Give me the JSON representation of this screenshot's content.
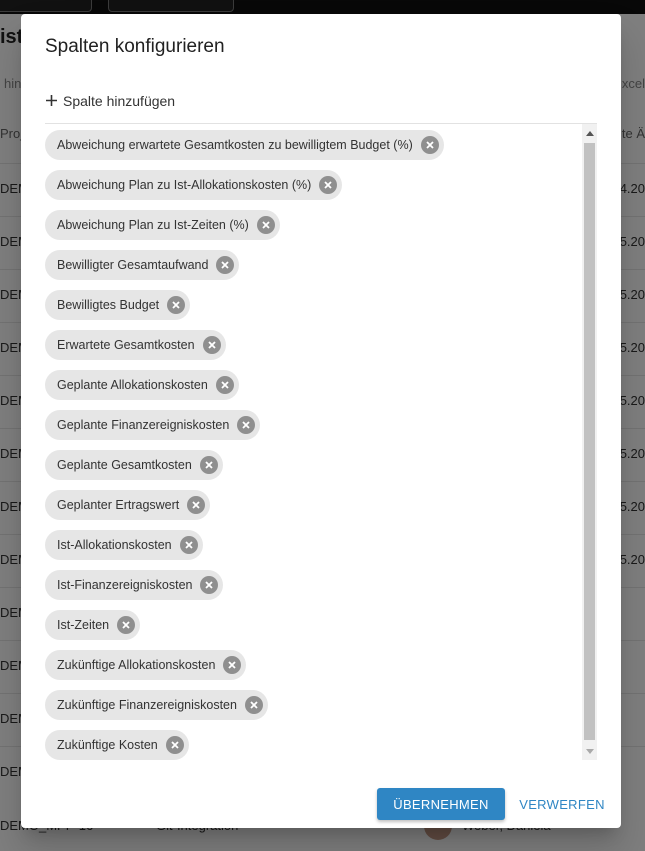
{
  "background": {
    "title_fragment": "ist",
    "hint_fragment": "hin",
    "excel_fragment": "xcel",
    "col_proj_fragment": "Proj",
    "col_right_fragment": "te Ä",
    "rows": [
      {
        "left": "DEM",
        "right": "4.20"
      },
      {
        "left": "DEM",
        "right": "5.20"
      },
      {
        "left": "DEM",
        "right": "5.20"
      },
      {
        "left": "DEM",
        "right": "5.20"
      },
      {
        "left": "DEM",
        "right": "5.20"
      },
      {
        "left": "DEM",
        "right": "5.20"
      },
      {
        "left": "DEM",
        "right": "5.20"
      },
      {
        "left": "DEM",
        "right": "5.20"
      },
      {
        "left": "DEM",
        "right": ""
      },
      {
        "left": "DEM",
        "right": ""
      },
      {
        "left": "DEM",
        "right": ""
      },
      {
        "left": "DEM",
        "right": ""
      }
    ],
    "last_row": {
      "left": "DEMO_MPP-16",
      "middle": "Git-Integration",
      "right": "Weber, Daniela"
    }
  },
  "dialog": {
    "title": "Spalten konfigurieren",
    "add_column": {
      "icon": "plus-icon",
      "label": "Spalte hinzufügen"
    },
    "columns": [
      "Abweichung erwartete Gesamtkosten zu bewilligtem Budget (%)",
      "Abweichung Plan zu Ist-Allokationskosten (%)",
      "Abweichung Plan zu Ist-Zeiten (%)",
      "Bewilligter Gesamtaufwand",
      "Bewilligtes Budget",
      "Erwartete Gesamtkosten",
      "Geplante Allokationskosten",
      "Geplante Finanzereigniskosten",
      "Geplante Gesamtkosten",
      "Geplanter Ertragswert",
      "Ist-Allokationskosten",
      "Ist-Finanzereigniskosten",
      "Ist-Zeiten",
      "Zukünftige Allokationskosten",
      "Zukünftige Finanzereigniskosten",
      "Zukünftige Kosten"
    ],
    "chip_remove_icon": "close-circle-icon",
    "buttons": {
      "apply": "ÜBERNEHMEN",
      "discard": "VERWERFEN"
    }
  },
  "colors": {
    "accent": "#2f86c4",
    "chip_bg": "#e6e6e6",
    "chip_remove": "#8f8f8f"
  }
}
